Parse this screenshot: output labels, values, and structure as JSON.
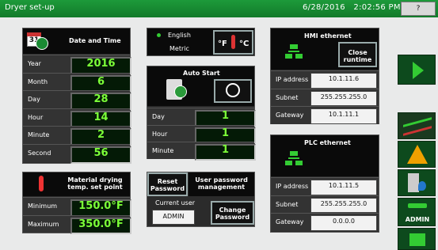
{
  "window": {
    "title": "Dryer set-up",
    "date": "6/28/2016",
    "time": "2:02:56 PM",
    "help_label": "?"
  },
  "date_time": {
    "title": "Date and Time",
    "calendar_day": "31",
    "rows": [
      {
        "label": "Year",
        "value": "2016"
      },
      {
        "label": "Month",
        "value": "6"
      },
      {
        "label": "Day",
        "value": "28"
      },
      {
        "label": "Hour",
        "value": "14"
      },
      {
        "label": "Minute",
        "value": "2"
      },
      {
        "label": "Second",
        "value": "56"
      }
    ]
  },
  "units": {
    "language": "English",
    "measure": "Metric",
    "f_label": "°F",
    "c_label": "°C"
  },
  "auto_start": {
    "title": "Auto Start",
    "rows": [
      {
        "label": "Day",
        "value": "1"
      },
      {
        "label": "Hour",
        "value": "1"
      },
      {
        "label": "Minute",
        "value": "1"
      }
    ]
  },
  "drying_temp": {
    "title": "Material drying temp. set point",
    "rows": [
      {
        "label": "Minimum",
        "value": "150.0°F"
      },
      {
        "label": "Maximum",
        "value": "350.0°F"
      }
    ]
  },
  "password": {
    "reset_label": "Reset Password",
    "mgmt_label": "User password management",
    "current_user_label": "Current user",
    "current_user": "ADMIN",
    "change_label": "Change Password"
  },
  "hmi_ethernet": {
    "title": "HMI ethernet",
    "close_label": "Close runtime",
    "rows": [
      {
        "label": "IP address",
        "value": "10.1.11.6"
      },
      {
        "label": "Subnet",
        "value": "255.255.255.0"
      },
      {
        "label": "Gateway",
        "value": "10.1.11.1"
      }
    ]
  },
  "plc_ethernet": {
    "title": "PLC ethernet",
    "rows": [
      {
        "label": "IP address",
        "value": "10.1.11.5"
      },
      {
        "label": "Subnet",
        "value": "255.255.255.0"
      },
      {
        "label": "Gateway",
        "value": "0.0.0.0"
      }
    ]
  },
  "sidebar": {
    "admin_label": "ADMIN"
  },
  "colors": {
    "title_green": "#1d9a3a",
    "value_green": "#7cff38",
    "panel": "#2b2b2b"
  }
}
